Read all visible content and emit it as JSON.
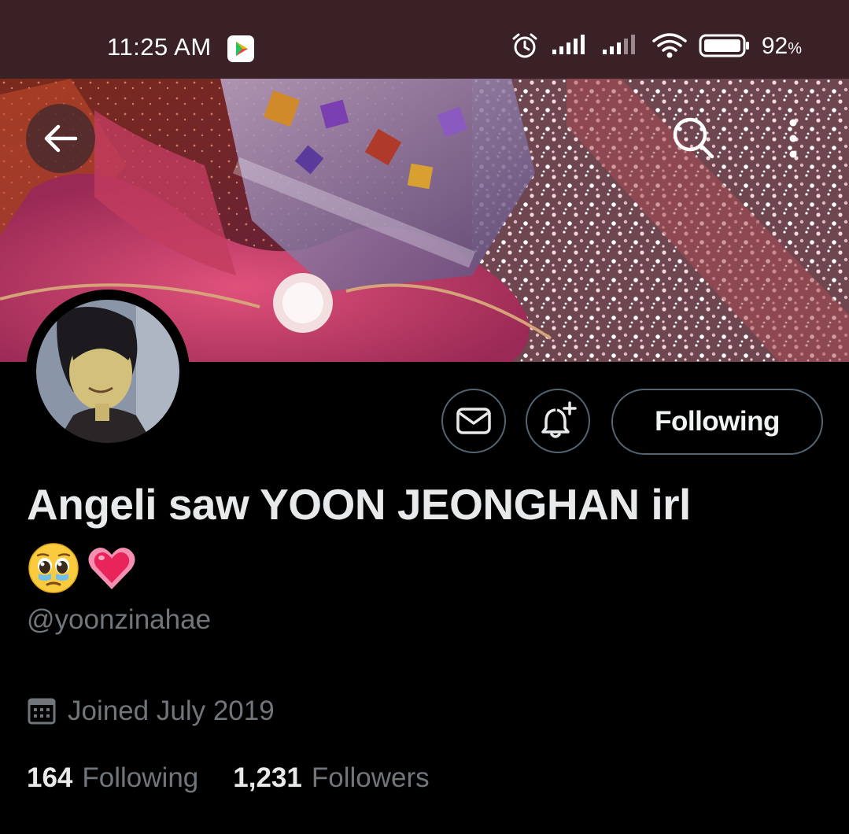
{
  "status_bar": {
    "time": "11:25 AM",
    "battery_value": "92",
    "battery_unit": "%",
    "app_icon": "play-store-icon",
    "icons": [
      "alarm-icon",
      "signal-icon",
      "signal-icon",
      "wifi-icon",
      "battery-icon"
    ]
  },
  "header": {
    "back_icon": "back-arrow-icon",
    "search_icon": "search-icon",
    "more_icon": "more-vertical-icon"
  },
  "profile": {
    "display_name": "Angeli saw YOON JEONGHAN irl",
    "name_emojis": [
      "🥹",
      "💗"
    ],
    "handle": "@yoonzinahae",
    "joined": "Joined July 2019",
    "following_count": "164",
    "following_label": "Following",
    "followers_count": "1,231",
    "followers_label": "Followers"
  },
  "actions": {
    "message_icon": "mail-icon",
    "notify_icon": "bell-plus-icon",
    "follow_state_label": "Following"
  },
  "colors": {
    "background": "#000000",
    "status_bar": "#3a2126",
    "primary_text": "#e7e9ea",
    "secondary_text": "#71767b",
    "button_border": "#536471"
  }
}
